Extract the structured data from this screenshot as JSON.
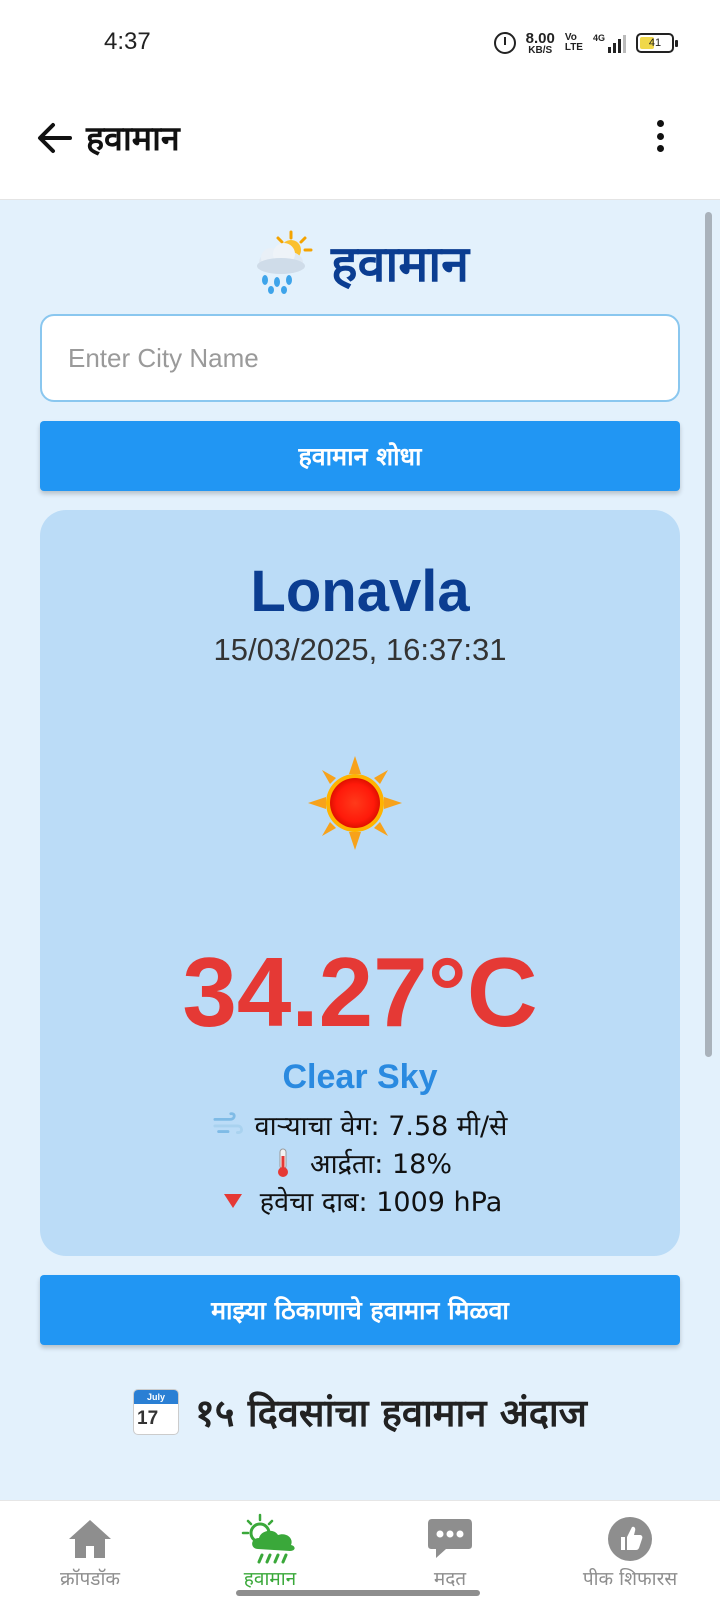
{
  "status_bar": {
    "time": "4:37",
    "net_speed": "8.00",
    "net_unit": "KB/S",
    "volte_top": "Vo",
    "volte_bottom": "LTE",
    "network": "4G",
    "battery": "41"
  },
  "app_bar": {
    "title": "हवामान"
  },
  "page": {
    "heading": "हवामान",
    "city_input_placeholder": "Enter City Name",
    "search_button": "हवामान शोधा",
    "location_button": "माझ्या ठिकाणाचे हवामान मिळवा",
    "forecast_heading": "१५ दिवसांचा हवामान अंदाज",
    "calendar_month": "July",
    "calendar_day": "17"
  },
  "weather": {
    "city": "Lonavla",
    "datetime": "15/03/2025, 16:37:31",
    "temperature": "34.27°C",
    "description": "Clear Sky",
    "wind": "वाऱ्याचा वेग: 7.58 मी/से",
    "humidity": "आर्द्रता: 18%",
    "pressure": "हवेचा दाब: 1009 hPa",
    "condition_icon": "sun-icon"
  },
  "bottom_nav": {
    "items": [
      {
        "label": "क्रॉपडॉक",
        "icon": "home-icon",
        "active": false
      },
      {
        "label": "हवामान",
        "icon": "weather-rain-icon",
        "active": true
      },
      {
        "label": "मदत",
        "icon": "chat-icon",
        "active": false
      },
      {
        "label": "पीक शिफारस",
        "icon": "thumbs-up-icon",
        "active": false
      }
    ]
  },
  "colors": {
    "primary": "#2196f3",
    "heading_blue": "#0b3d91",
    "temperature_red": "#e53935",
    "card_bg": "#bbdcf7",
    "page_bg": "#e3f1fc",
    "active_nav": "#3aa83a"
  }
}
